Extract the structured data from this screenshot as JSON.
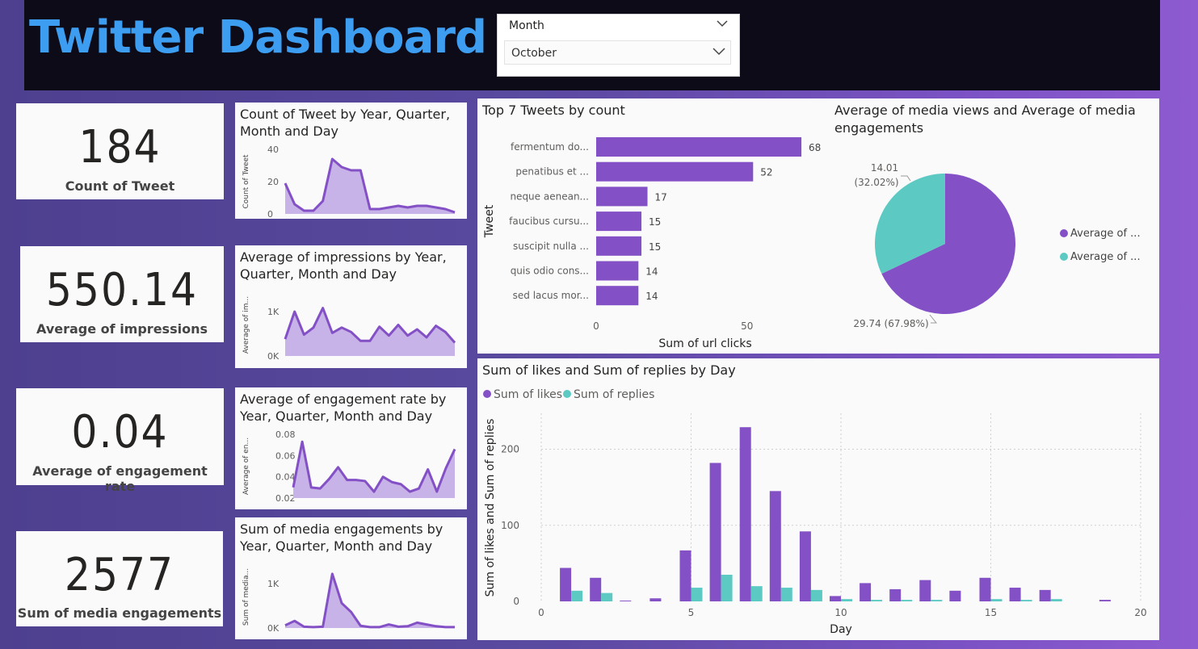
{
  "header": {
    "title": "Twitter Dashboard"
  },
  "slicer": {
    "field": "Month",
    "selected": "October"
  },
  "colors": {
    "purple": "#8450c6",
    "teal": "#5ccac3",
    "area": "#c8b3e8",
    "title_blue": "#3d9df0"
  },
  "cards": [
    {
      "value": "184",
      "label": "Count of Tweet"
    },
    {
      "value": "550.14",
      "label": "Average of impressions"
    },
    {
      "value": "0.04",
      "label": "Average of engagement rate"
    },
    {
      "value": "2577",
      "label": "Sum of media engagements"
    }
  ],
  "minis": [
    {
      "title": "Count of Tweet by Year, Quarter, Month and Day",
      "ylabel": "Count of Tweet",
      "ticks": [
        "40",
        "20",
        "0"
      ]
    },
    {
      "title": "Average of impressions by Year, Quarter, Month and Day",
      "ylabel": "Average of im...",
      "ticks": [
        "1K",
        "0K"
      ]
    },
    {
      "title": "Average of engagement rate by Year, Quarter, Month and Day",
      "ylabel": "Average of en...",
      "ticks": [
        "0.08",
        "0.06",
        "0.04",
        "0.02"
      ]
    },
    {
      "title": "Sum of media engagements by Year, Quarter, Month and Day",
      "ylabel": "Sum of media...",
      "ticks": [
        "1K",
        "0K"
      ]
    }
  ],
  "top_tweets": {
    "title": "Top 7 Tweets by count",
    "ylabel": "Tweet",
    "xlabel": "Sum of url clicks"
  },
  "pie": {
    "title": "Average of media views and Average of media engagements",
    "legend": [
      "Average of ...",
      "Average of ..."
    ],
    "labels": [
      "14.01",
      "(32.02%)",
      "29.74 (67.98%)"
    ]
  },
  "likes": {
    "title": "Sum of likes and Sum of replies by Day",
    "legend": [
      "Sum of likes",
      "Sum of replies"
    ],
    "ylabel": "Sum of likes and Sum of replies",
    "xlabel": "Day"
  },
  "chart_data": [
    {
      "type": "area",
      "title": "Count of Tweet by Year, Quarter, Month and Day",
      "ylabel": "Count of Tweet",
      "ylim": [
        0,
        40
      ],
      "yticks": [
        0,
        20,
        40
      ],
      "values": [
        19,
        6,
        2,
        2,
        8,
        34,
        29,
        27,
        27,
        3,
        3,
        4,
        5,
        4,
        5,
        5,
        4,
        3,
        1
      ]
    },
    {
      "type": "area",
      "title": "Average of impressions by Year, Quarter, Month and Day",
      "ylabel": "Average of im...",
      "ylim": [
        0,
        1400
      ],
      "yticks": [
        0,
        1000
      ],
      "ytick_labels": [
        "0K",
        "1K"
      ],
      "values": [
        380,
        1000,
        480,
        640,
        1080,
        520,
        640,
        540,
        340,
        340,
        660,
        460,
        700,
        460,
        600,
        420,
        680,
        540,
        300
      ]
    },
    {
      "type": "area",
      "title": "Average of engagement rate by Year, Quarter, Month and Day",
      "ylabel": "Average of en...",
      "ylim": [
        0.02,
        0.08
      ],
      "yticks": [
        0.02,
        0.04,
        0.06,
        0.08
      ],
      "values": [
        0.03,
        0.073,
        0.03,
        0.029,
        0.038,
        0.049,
        0.037,
        0.037,
        0.036,
        0.026,
        0.04,
        0.035,
        0.033,
        0.026,
        0.029,
        0.047,
        0.026,
        0.048,
        0.066
      ]
    },
    {
      "type": "area",
      "title": "Sum of media engagements by Year, Quarter, Month and Day",
      "ylabel": "Sum of media...",
      "ylim": [
        0,
        1400
      ],
      "yticks": [
        0,
        1000
      ],
      "ytick_labels": [
        "0K",
        "1K"
      ],
      "values": [
        60,
        160,
        30,
        20,
        30,
        1220,
        560,
        360,
        50,
        20,
        20,
        80,
        30,
        40,
        120,
        80,
        40,
        20,
        20
      ]
    },
    {
      "type": "bar",
      "orientation": "horizontal",
      "title": "Top 7 Tweets by count",
      "xlabel": "Sum of url clicks",
      "ylabel": "Tweet",
      "xlim": [
        0,
        72
      ],
      "xticks": [
        0,
        50
      ],
      "categories": [
        "fermentum do...",
        "penatibus et ...",
        "neque aenean...",
        "faucibus cursu...",
        "suscipit nulla ...",
        "quis odio cons...",
        "sed lacus mor..."
      ],
      "values": [
        68,
        52,
        17,
        15,
        15,
        14,
        14
      ]
    },
    {
      "type": "pie",
      "title": "Average of media views and Average of media engagements",
      "values": [
        29.74,
        14.01
      ],
      "percents": [
        "67.98%",
        "32.02%"
      ],
      "legend": [
        "Average of ...",
        "Average of ..."
      ],
      "colors": [
        "#8450c6",
        "#5ccac3"
      ]
    },
    {
      "type": "bar",
      "title": "Sum of likes and Sum of replies by Day",
      "xlabel": "Day",
      "ylabel": "Sum of likes and Sum of replies",
      "xlim": [
        0,
        20
      ],
      "xticks": [
        0,
        5,
        10,
        15,
        20
      ],
      "ylim": [
        0,
        260
      ],
      "yticks": [
        0,
        100,
        200
      ],
      "x": [
        1,
        2,
        3,
        4,
        5,
        6,
        7,
        8,
        9,
        10,
        11,
        12,
        13,
        14,
        15,
        16,
        17,
        18,
        19
      ],
      "series": [
        {
          "name": "Sum of likes",
          "values": [
            44,
            31,
            1,
            4,
            67,
            182,
            229,
            145,
            92,
            7,
            24,
            16,
            28,
            14,
            31,
            18,
            15,
            0,
            2
          ]
        },
        {
          "name": "Sum of replies",
          "values": [
            14,
            11,
            0,
            0,
            18,
            35,
            20,
            18,
            15,
            3,
            2,
            2,
            2,
            0,
            3,
            2,
            3,
            0,
            0
          ]
        }
      ]
    }
  ]
}
